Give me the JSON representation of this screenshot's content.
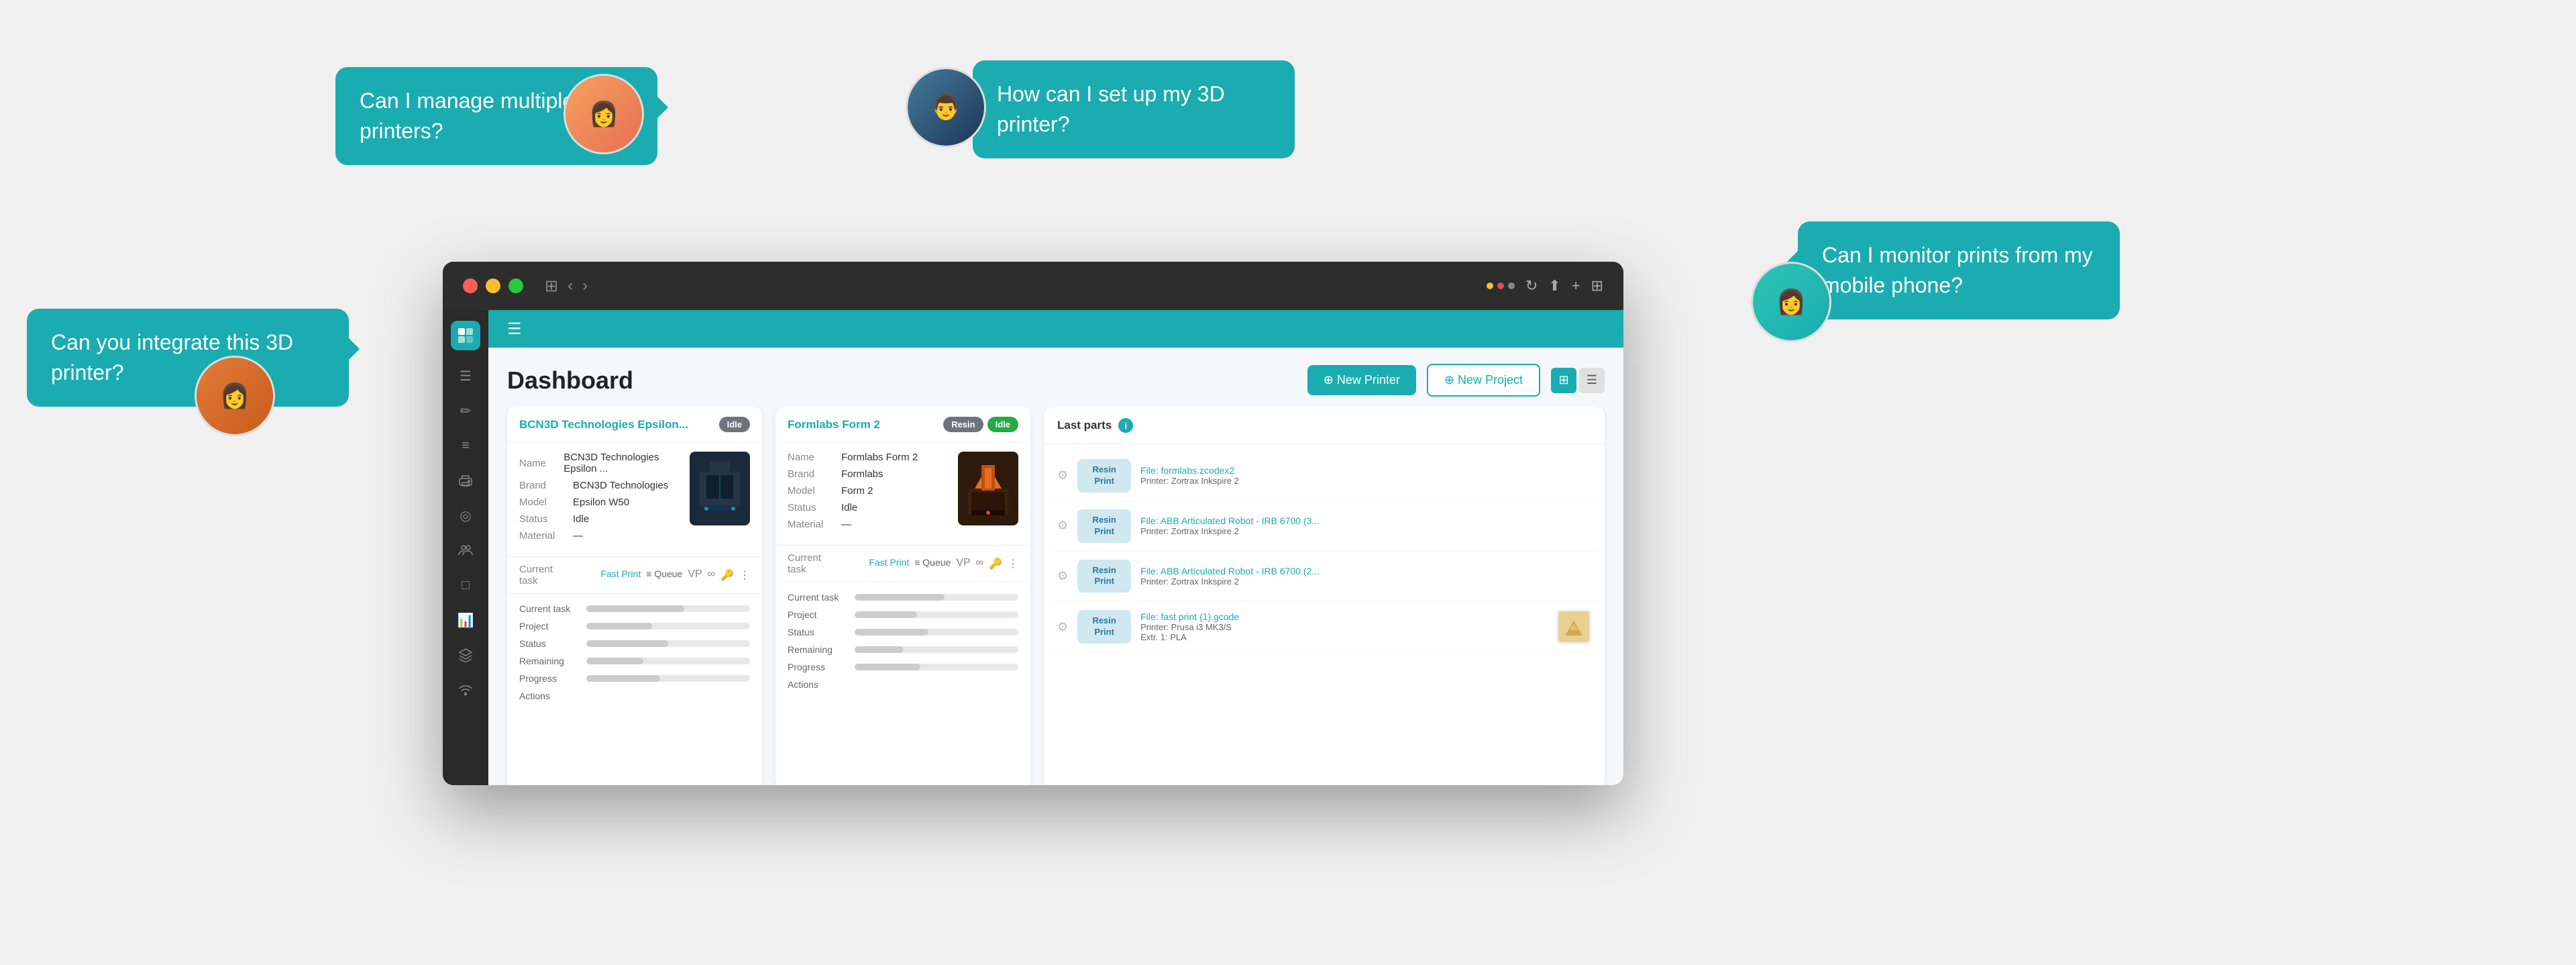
{
  "bubbles": {
    "b1": {
      "text": "Can I manage\nmultiple 3D printers?",
      "class": "chat-bubble-1 bubble bubble-right"
    },
    "b2": {
      "text": "How can I set up\nmy 3D printer?",
      "class": "chat-bubble-2 bubble bubble-left"
    },
    "b3": {
      "text": "Can you integrate\nthis 3D printer?",
      "class": "chat-bubble-3 bubble bubble-right"
    },
    "b4": {
      "text": "Can I monitor prints\nfrom my mobile phone?",
      "class": "chat-bubble-4 bubble bubble-left"
    }
  },
  "browser": {
    "titlebar": {
      "tl_red": "#ff5f57",
      "tl_yellow": "#ffbd2e",
      "tl_green": "#28c840"
    }
  },
  "app": {
    "nav_color": "#1aacb0",
    "page_title": "Dashboard",
    "btn_new_printer": "⊕ New Printer",
    "btn_new_project": "⊕ New Project"
  },
  "sidebar_icons": [
    "☰",
    "✏",
    "📋",
    "≡",
    "⊙",
    "👥",
    "□",
    "📊",
    "⚙",
    "📡"
  ],
  "printer1": {
    "name": "BCN3D Technologies Epsilon...",
    "status": "Idle",
    "status_badge": "Idle",
    "name_label": "Name",
    "name_value": "BCN3D Technologies Epsilon ...",
    "brand_label": "Brand",
    "brand_value": "BCN3D Technologies",
    "model_label": "Model",
    "model_value": "Epsilon W50",
    "status_label": "Status",
    "status_value": "Idle",
    "material_label": "Material",
    "material_value": "—",
    "current_task_label": "Current task",
    "fast_print_label": "Fast Print",
    "queue_label": "≡ Queue",
    "task_rows": [
      {
        "label": "Current task"
      },
      {
        "label": "Project"
      },
      {
        "label": "Status"
      },
      {
        "label": "Remaining"
      },
      {
        "label": "Progress"
      },
      {
        "label": "Actions"
      }
    ]
  },
  "printer2": {
    "name": "Formlabs Form 2",
    "status_resin": "Resin",
    "status_idle": "Idle",
    "name_label": "Name",
    "name_value": "Formlabs Form 2",
    "brand_label": "Brand",
    "brand_value": "Formlabs",
    "model_label": "Model",
    "model_value": "Form 2",
    "status_label": "Status",
    "status_value": "Idle",
    "material_label": "Material",
    "material_value": "—",
    "current_task_label": "Current task",
    "fast_print_label": "Fast Print",
    "queue_label": "≡ Queue",
    "task_rows": [
      {
        "label": "Current task"
      },
      {
        "label": "Project"
      },
      {
        "label": "Status"
      },
      {
        "label": "Remaining"
      },
      {
        "label": "Progress"
      },
      {
        "label": "Actions"
      }
    ]
  },
  "last_parts": {
    "title": "Last parts",
    "items": [
      {
        "badge_line1": "Resin",
        "badge_line2": "Print",
        "file": "File: formlabs.zcodex2",
        "printer": "Printer: Zortrax Inkspire 2",
        "has_thumb": false
      },
      {
        "badge_line1": "Resin",
        "badge_line2": "Print",
        "file": "File: ABB Articulated Robot - IRB 6700 (3...",
        "printer": "Printer: Zortrax Inkspire 2",
        "has_thumb": false
      },
      {
        "badge_line1": "Resin",
        "badge_line2": "Print",
        "file": "File: ABB Articulated Robot - IRB 6700 (2...",
        "printer": "Printer: Zortrax Inkspire 2",
        "has_thumb": false
      },
      {
        "badge_line1": "Resin",
        "badge_line2": "Print",
        "file": "File: fast print (1).gcode",
        "printer": "Printer: Prusa i3 MK3/S",
        "extrusion": "Extr. 1: PLA",
        "has_thumb": true
      }
    ]
  }
}
